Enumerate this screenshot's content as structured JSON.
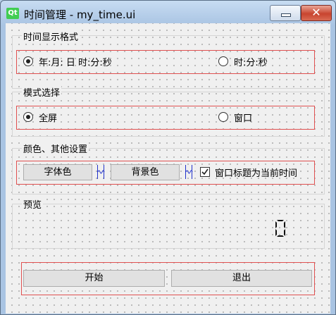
{
  "window": {
    "app_icon": "Qt",
    "title": "时间管理 - my_time.ui",
    "minimize_icon": "minimize-icon",
    "close_icon": "close-icon"
  },
  "format_group": {
    "title": "时间显示格式",
    "options": [
      {
        "label": "年:月: 日 时:分:秒",
        "checked": true
      },
      {
        "label": "时:分:秒",
        "checked": false
      }
    ]
  },
  "mode_group": {
    "title": "模式选择",
    "options": [
      {
        "label": "全屏",
        "checked": true
      },
      {
        "label": "窗口",
        "checked": false
      }
    ]
  },
  "color_group": {
    "title": "颜色、其他设置",
    "font_color_button": "字体色",
    "bg_color_button": "背景色",
    "title_checkbox_label": "窗口标题为当前时间",
    "title_checkbox_checked": true
  },
  "preview_group": {
    "title": "预览",
    "lcd_value": "0"
  },
  "actions": {
    "start_button": "开始",
    "exit_button": "退出"
  }
}
